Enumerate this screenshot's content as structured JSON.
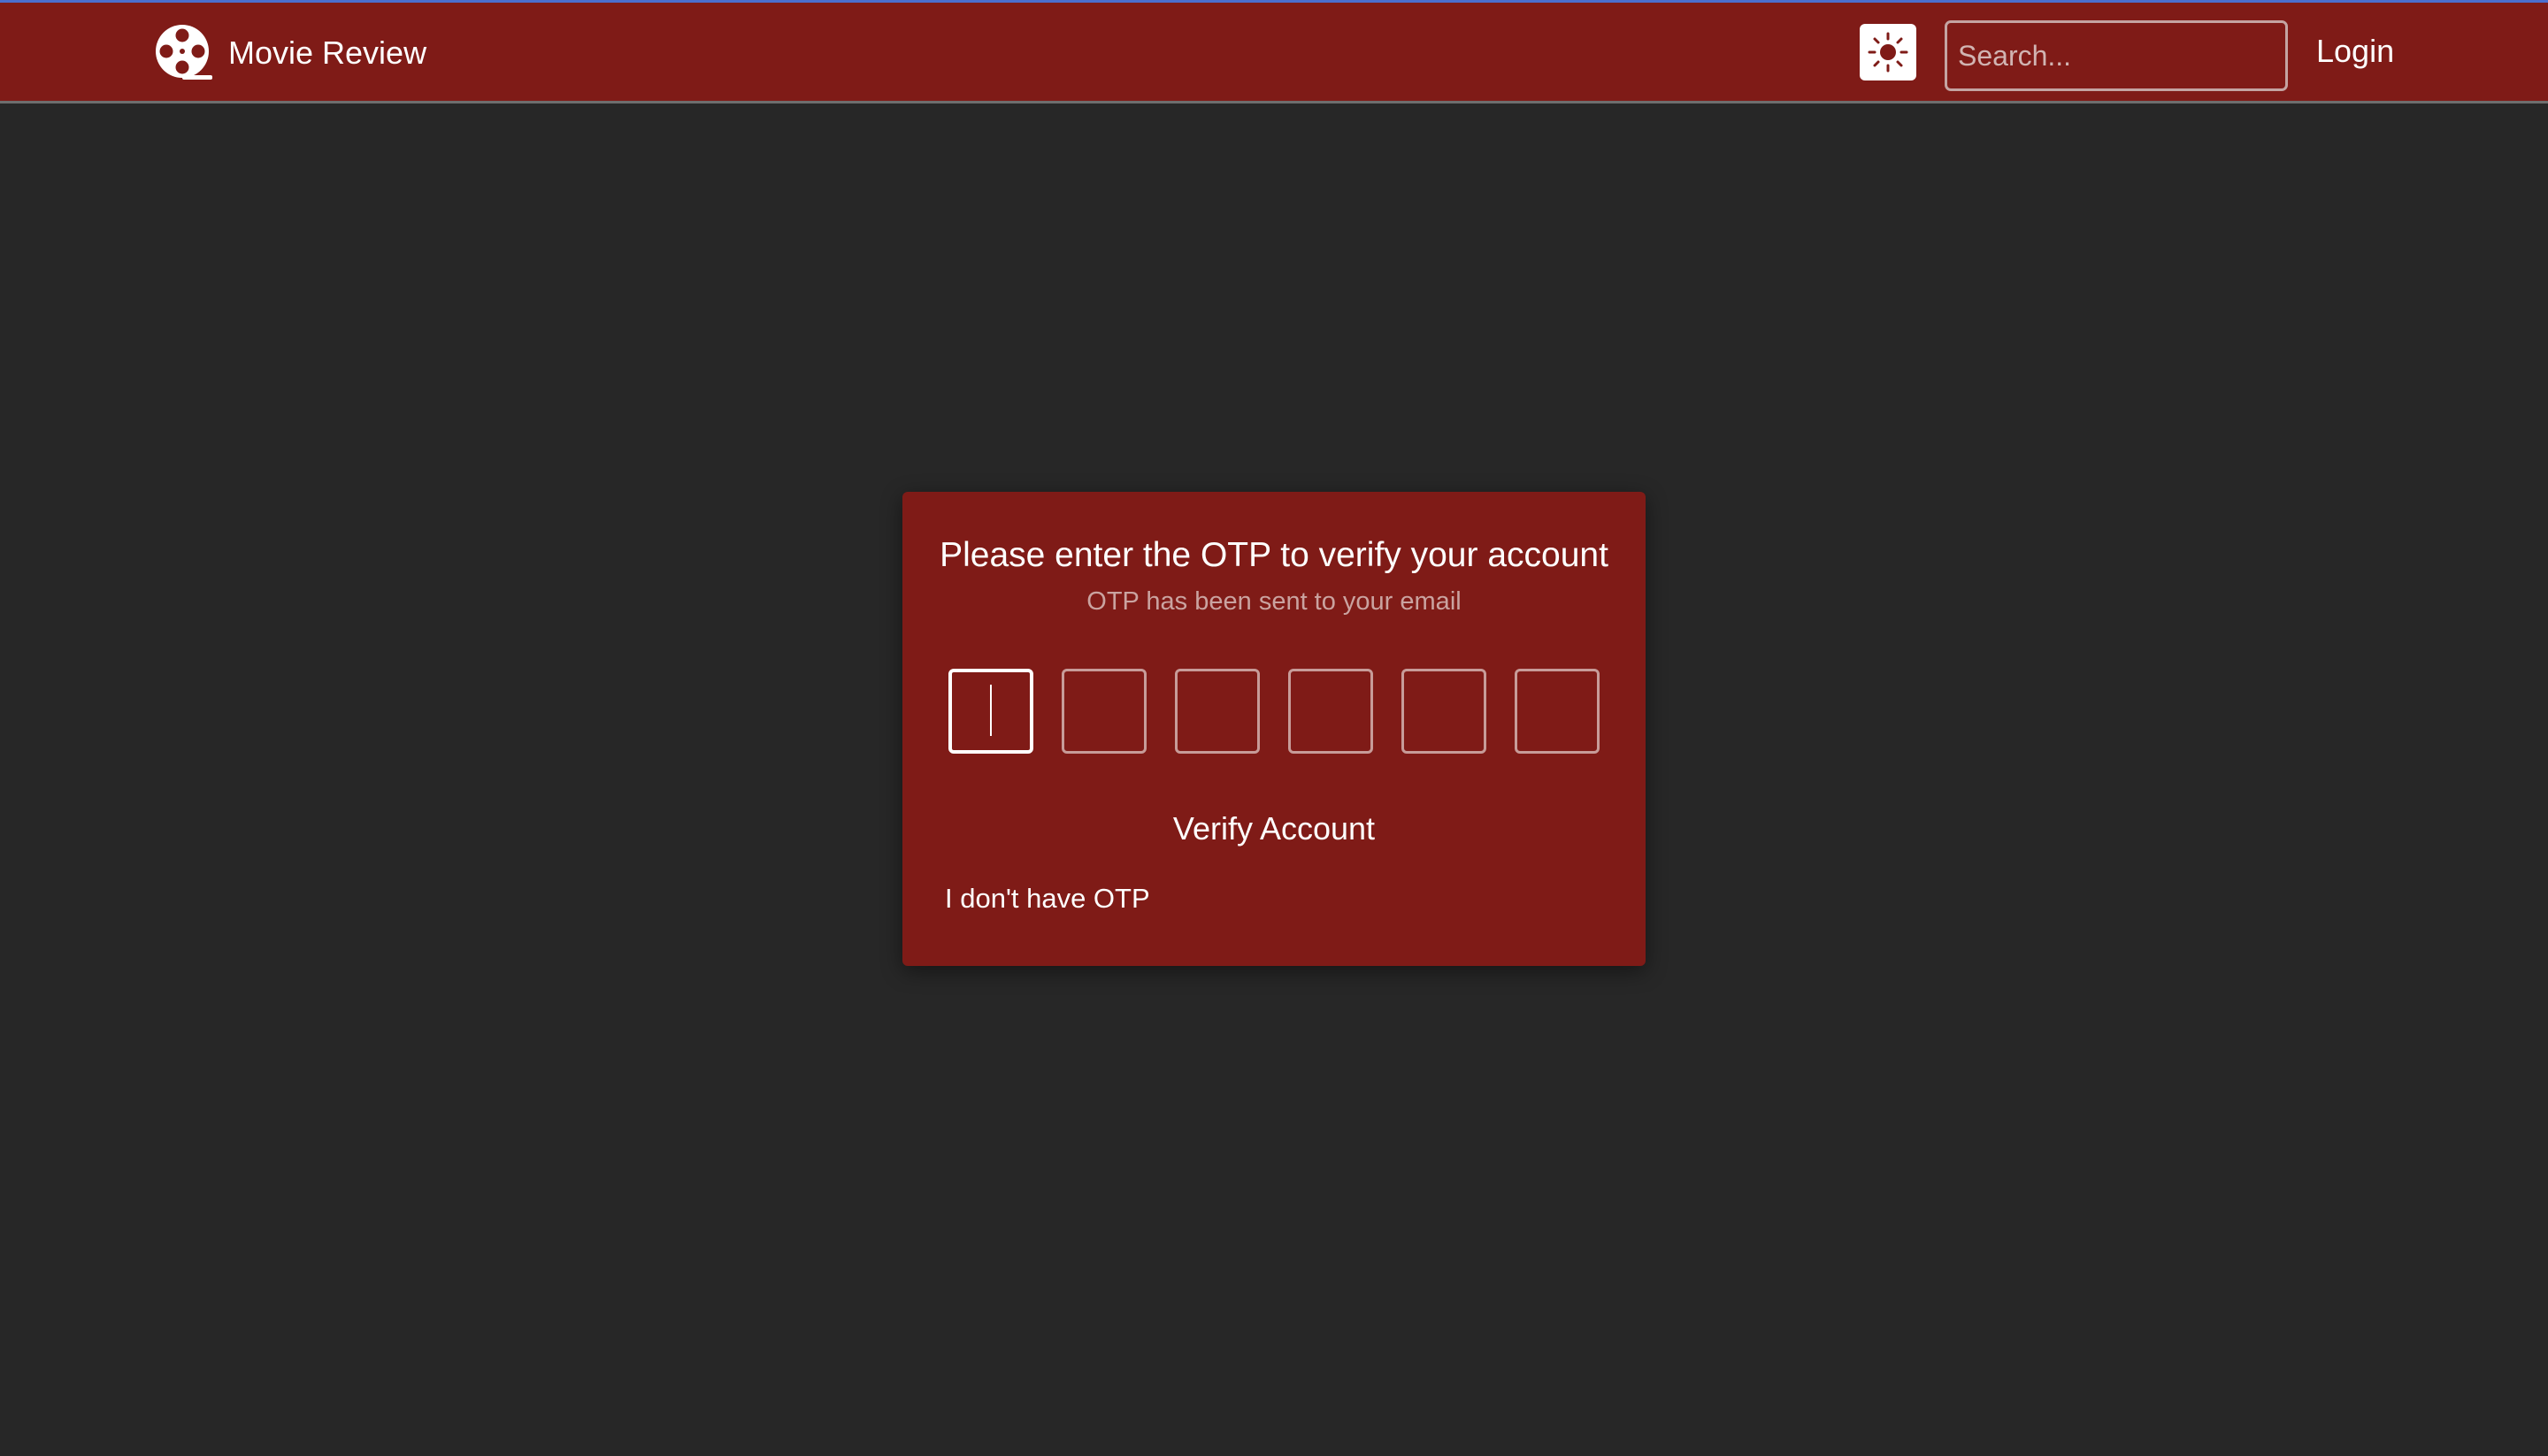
{
  "navbar": {
    "brand_title": "Movie Review",
    "brand_icon": "film-reel-icon",
    "theme_toggle_icon": "sun-icon",
    "search_placeholder": "Search...",
    "search_value": "",
    "login_label": "Login"
  },
  "otp_card": {
    "title": "Please enter the OTP to verify your account",
    "subtitle": "OTP has been sent to your email",
    "digits": [
      "",
      "",
      "",
      "",
      "",
      ""
    ],
    "verify_label": "Verify Account",
    "no_otp_label": "I don't have OTP"
  },
  "colors": {
    "primary": "#7f1b17",
    "background": "#272727",
    "text": "#ffffff",
    "muted_text": "#caa3a0"
  }
}
